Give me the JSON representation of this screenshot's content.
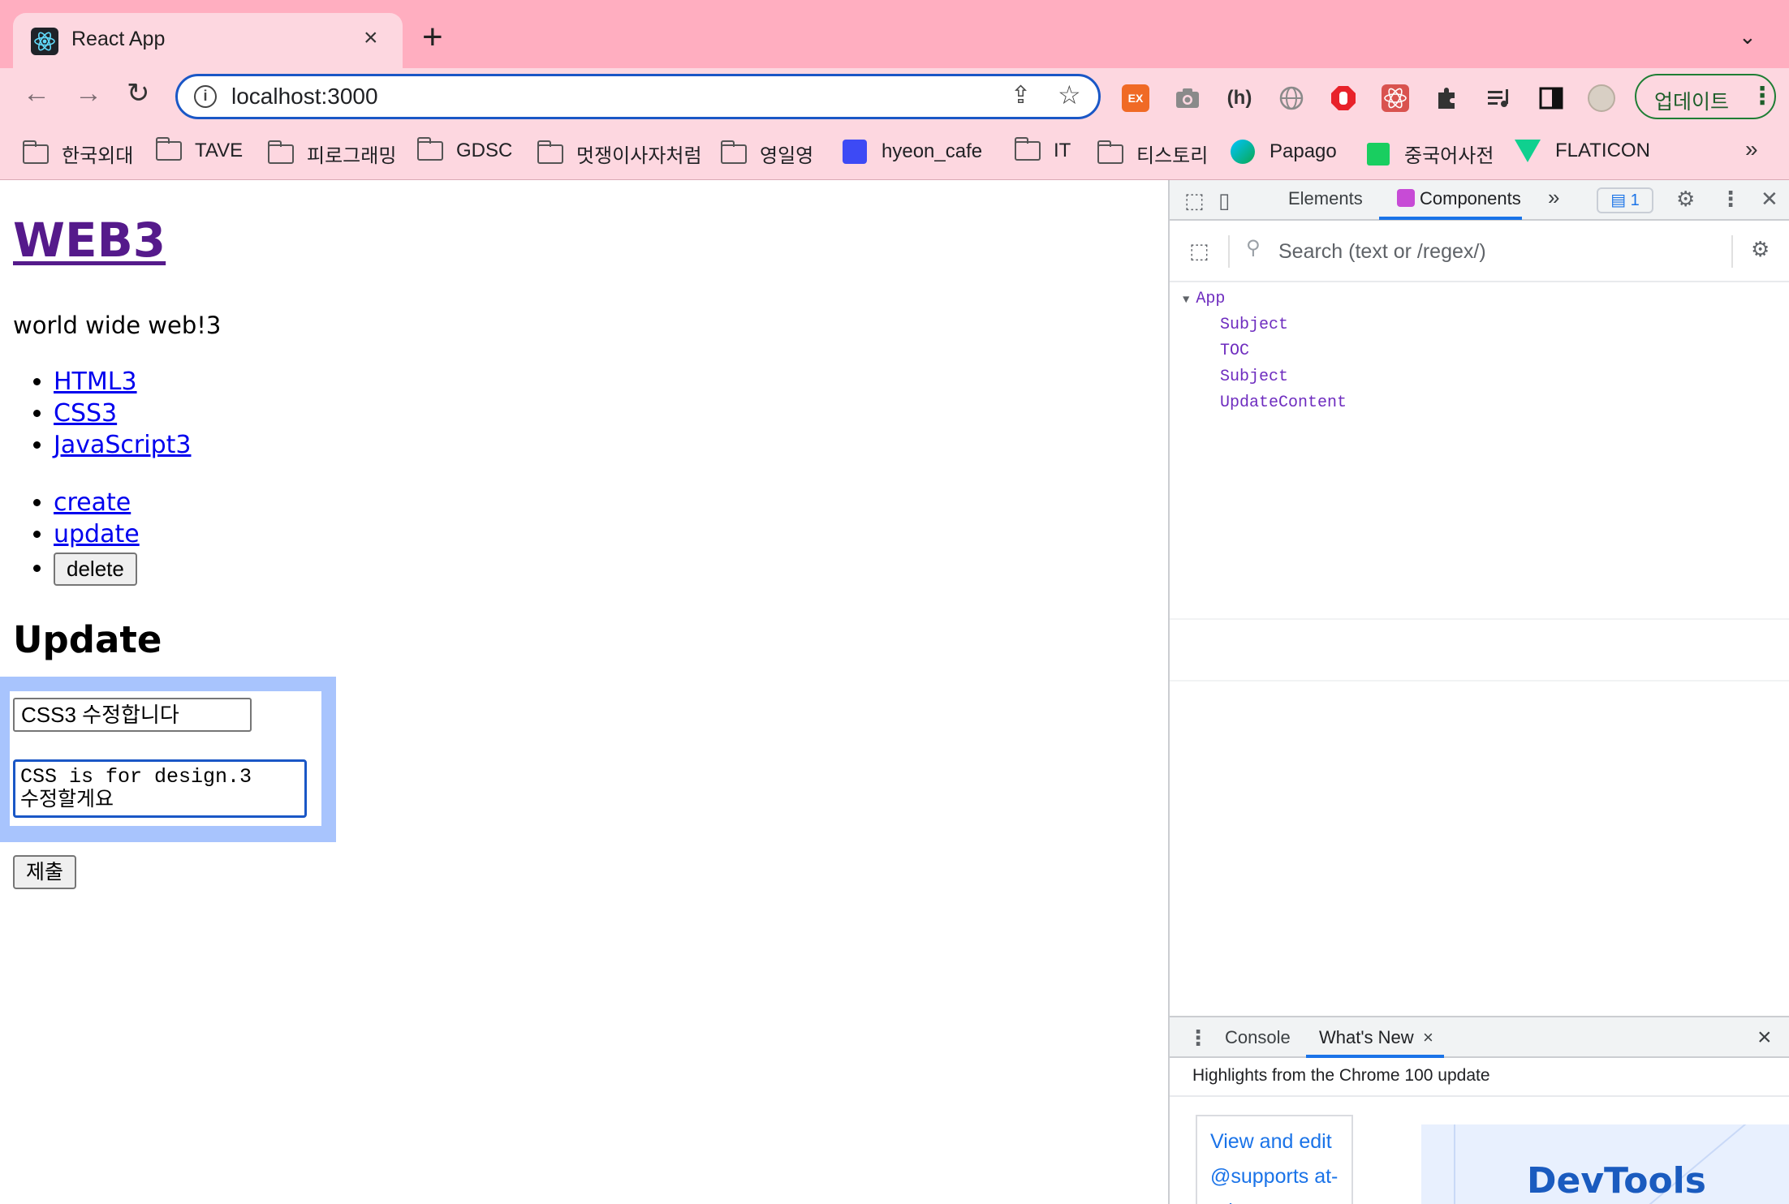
{
  "browser": {
    "tab_title": "React App",
    "tab_close": "×",
    "new_tab": "+",
    "tab_menu": "⌄",
    "url": "localhost:3000",
    "update_label": "업데이트",
    "bookmarks": [
      {
        "label": "한국외대",
        "type": "folder"
      },
      {
        "label": "TAVE",
        "type": "folder"
      },
      {
        "label": "피로그래밍",
        "type": "folder"
      },
      {
        "label": "GDSC",
        "type": "folder"
      },
      {
        "label": "멋쟁이사자처럼",
        "type": "folder"
      },
      {
        "label": "영일영",
        "type": "folder"
      },
      {
        "label": "hyeon_cafe",
        "type": "site"
      },
      {
        "label": "IT",
        "type": "folder"
      },
      {
        "label": "티스토리",
        "type": "folder"
      },
      {
        "label": "Papago",
        "type": "site"
      },
      {
        "label": "중국어사전",
        "type": "site"
      },
      {
        "label": "FLATICON",
        "type": "site"
      }
    ],
    "bookmarks_overflow": "»",
    "extension_colors": {
      "ex": "#f06a25",
      "camera": "#8a8a8a",
      "hackmd": "#333333",
      "globe": "#8a8a8a",
      "adblock": "#e8222a",
      "react_devtools": "#d9534f",
      "puzzle": "#333333",
      "playlist": "#333333",
      "sidepanel": "#111111"
    }
  },
  "page": {
    "title": "WEB3",
    "description": "world wide web!3",
    "toc": [
      "HTML3",
      "CSS3",
      "JavaScript3"
    ],
    "controls": {
      "create": "create",
      "update": "update",
      "delete": "delete"
    },
    "form_heading": "Update",
    "title_value": "CSS3 수정합니다",
    "desc_value": "CSS is for design.3\n수정할게요",
    "submit_label": "제출"
  },
  "devtools": {
    "tabs": {
      "elements": "Elements",
      "components": "Components",
      "more": "»"
    },
    "issues_count": "1",
    "search_placeholder": "Search (text or /regex/)",
    "tree": {
      "root": "App",
      "children": [
        "Subject",
        "TOC",
        "Subject",
        "UpdateContent"
      ]
    },
    "drawer": {
      "console_tab": "Console",
      "whats_new_tab": "What's New",
      "tab_close": "×",
      "close": "×",
      "message": "Highlights from the Chrome 100 update",
      "card_text": "View and edit @supports at-rules",
      "promo_logo": "DevTools"
    }
  }
}
